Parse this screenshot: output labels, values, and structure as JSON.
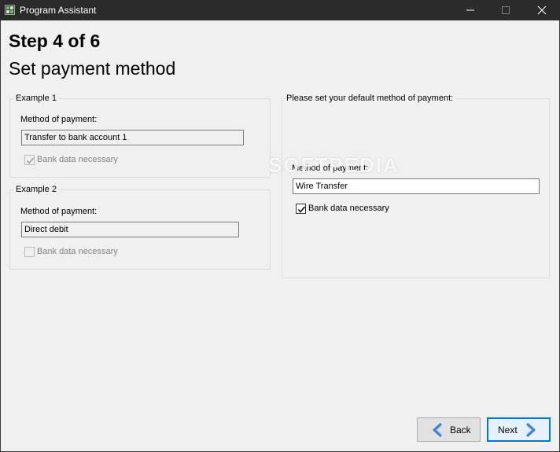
{
  "window": {
    "title": "Program Assistant",
    "icons": [
      "app-icon",
      "minimize-icon",
      "maximize-icon",
      "close-icon"
    ]
  },
  "header": {
    "step": "Step 4 of 6",
    "subtitle": "Set payment method"
  },
  "example1": {
    "legend": "Example 1",
    "method_label": "Method of payment:",
    "method_value": "Transfer to bank account 1",
    "bank_label": "Bank data necessary",
    "bank_checked": true
  },
  "example2": {
    "legend": "Example 2",
    "method_label": "Method of payment:",
    "method_value": "Direct debit",
    "bank_label": "Bank data necessary",
    "bank_checked": false
  },
  "default_payment": {
    "legend": "Please set your default method of payment:",
    "method_label": "Method of payment:",
    "method_value": "Wire Transfer",
    "bank_label": "Bank data necessary",
    "bank_checked": true
  },
  "watermark": "SOFTPEDIA",
  "buttons": {
    "back_label": "Back",
    "next_label": "Next"
  },
  "colors": {
    "titlebar": "#2b2b2b",
    "background": "#f0f0f0",
    "accent": "#0078d7",
    "arrow": "#3d7fd6"
  }
}
